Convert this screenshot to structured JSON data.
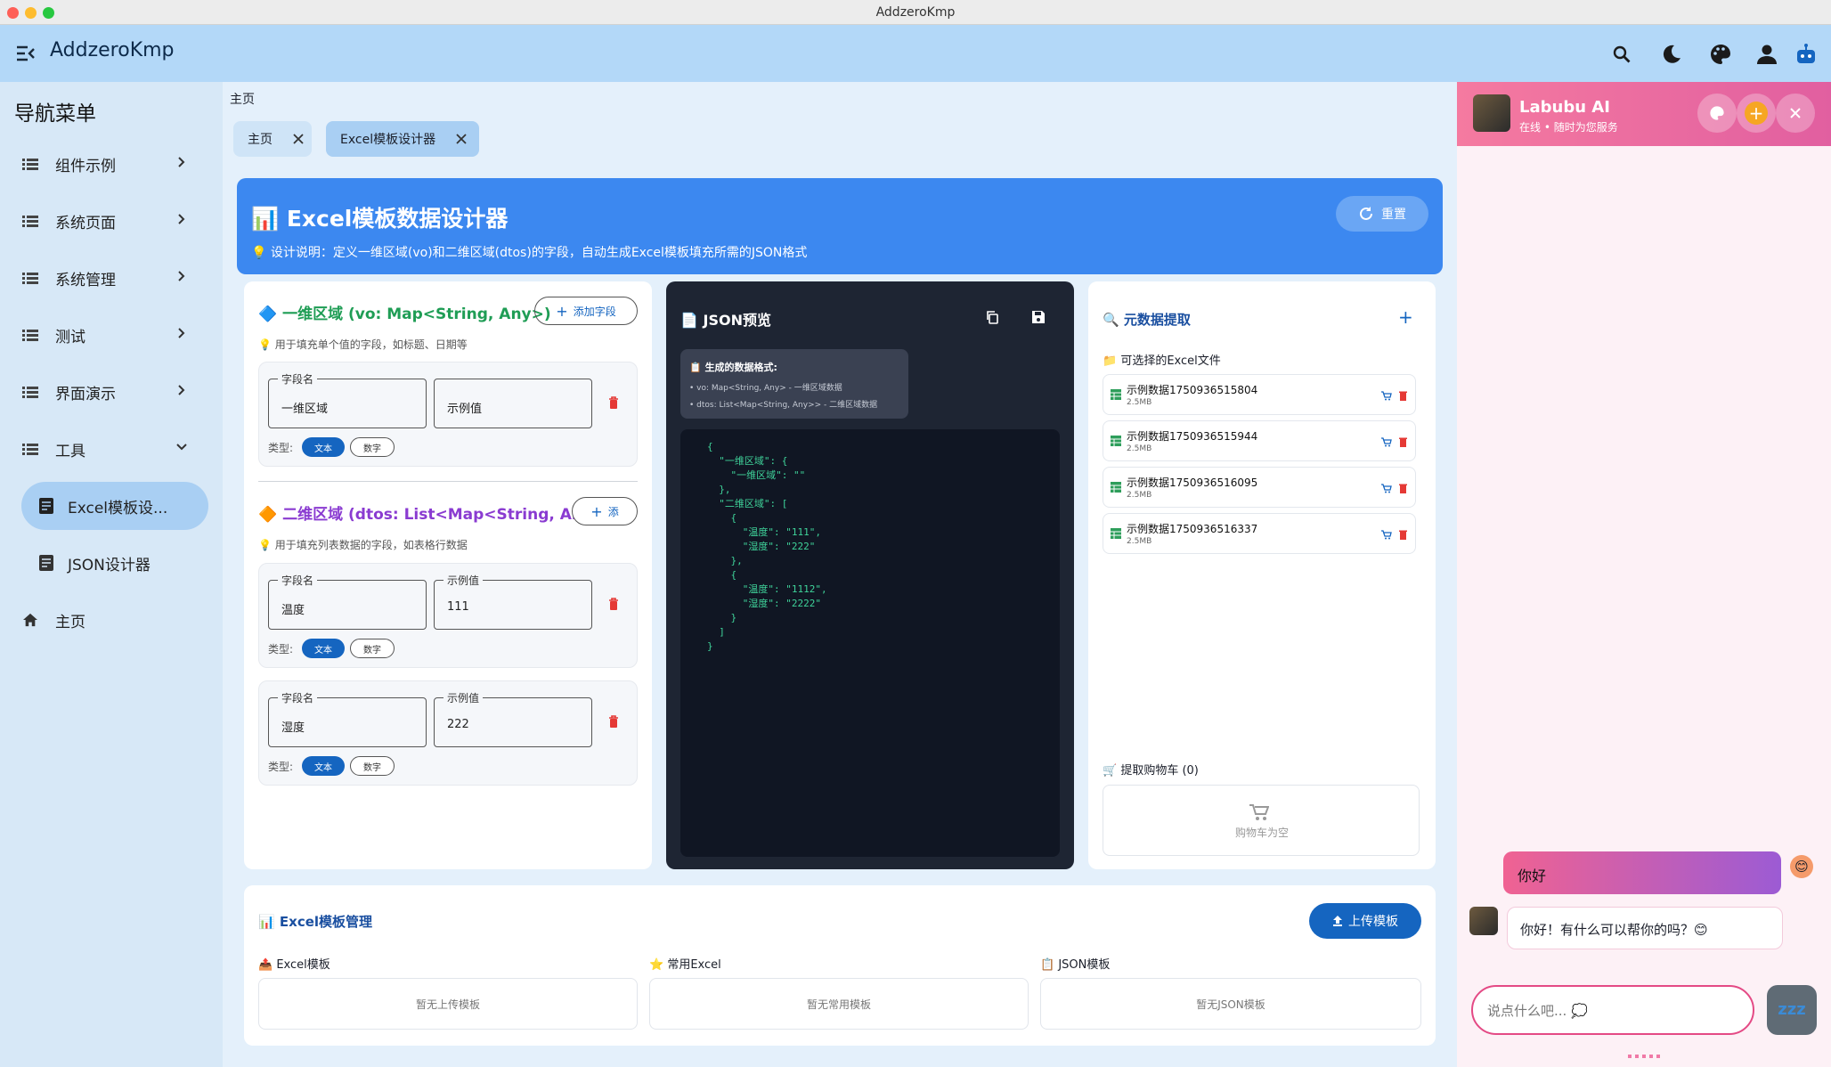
{
  "window": {
    "title": "AddzeroKmp"
  },
  "appbar": {
    "title": "AddzeroKmp",
    "icons": [
      "search-icon",
      "moon-icon",
      "palette-icon",
      "account-icon",
      "robot-icon"
    ]
  },
  "sidebar": {
    "title": "导航菜单",
    "items": [
      {
        "label": "组件示例"
      },
      {
        "label": "系统页面"
      },
      {
        "label": "系统管理"
      },
      {
        "label": "测试"
      },
      {
        "label": "界面演示"
      },
      {
        "label": "工具"
      }
    ],
    "sub_items": [
      {
        "label": "Excel模板设..."
      },
      {
        "label": "JSON设计器"
      }
    ],
    "home": "主页"
  },
  "breadcrumb": "主页",
  "tabs": [
    {
      "label": "主页"
    },
    {
      "label": "Excel模板设计器"
    }
  ],
  "header": {
    "title": "📊 Excel模板数据设计器",
    "desc": "💡 设计说明：定义一维区域(vo)和二维区域(dtos)的字段，自动生成Excel模板填充所需的JSON格式",
    "reset": "重置"
  },
  "vo": {
    "title": "🔷 一维区域 (vo: Map<String, Any>)",
    "add": "添加字段",
    "hint": "💡 用于填充单个值的字段，如标题、日期等",
    "fields": [
      {
        "name_label": "字段名",
        "name": "一维区域",
        "value_label": "",
        "value": "示例值"
      }
    ]
  },
  "dtos": {
    "title": "🔶 二维区域 (dtos: List<Map<String, Any>>)",
    "add": "添",
    "hint": "💡 用于填充列表数据的字段，如表格行数据",
    "fields": [
      {
        "name_label": "字段名",
        "name": "温度",
        "value_label": "示例值",
        "value": "111"
      },
      {
        "name_label": "字段名",
        "name": "湿度",
        "value_label": "示例值",
        "value": "222"
      }
    ]
  },
  "type_row": {
    "label": "类型:",
    "text": "文本",
    "number": "数字"
  },
  "json": {
    "title": "📄 JSON预览",
    "format_title": "📋 生成的数据格式:",
    "line1": "• vo: Map<String, Any> - 一维区域数据",
    "line2": "• dtos: List<Map<String, Any>> - 二维区域数据",
    "code": "{\n  \"一维区域\": {\n    \"一维区域\": \"\"\n  },\n  \"二维区域\": [\n    {\n      \"温度\": \"111\",\n      \"湿度\": \"222\"\n    },\n    {\n      \"温度\": \"1112\",\n      \"湿度\": \"2222\"\n    }\n  ]\n}"
  },
  "meta": {
    "title": "🔍 元数据提取",
    "files_title": "📁 可选择的Excel文件",
    "files": [
      {
        "name": "示例数据1750936515804",
        "size": "2.5MB"
      },
      {
        "name": "示例数据1750936515944",
        "size": "2.5MB"
      },
      {
        "name": "示例数据1750936516095",
        "size": "2.5MB"
      },
      {
        "name": "示例数据1750936516337",
        "size": "2.5MB"
      }
    ],
    "cart_title": "🛒 提取购物车 (0)",
    "cart_empty": "购物车为空"
  },
  "manage": {
    "title": "📊 Excel模板管理",
    "upload": "上传模板",
    "cols": [
      {
        "title": "📤 Excel模板",
        "empty": "暂无上传模板"
      },
      {
        "title": "⭐ 常用Excel",
        "empty": "暂无常用模板"
      },
      {
        "title": "📋 JSON模板",
        "empty": "暂无JSON模板"
      }
    ]
  },
  "chat": {
    "name": "Labubu AI",
    "status": "在线 • 随时为您服务",
    "user_msg": "你好",
    "bot_msg": "你好！有什么可以帮你的吗？😊",
    "placeholder": "说点什么吧... 💭",
    "send_icon": "zzz"
  },
  "colors": {
    "appbar": "#b3d8f8",
    "accent": "#3c88f0",
    "primary": "#1565c0",
    "chat_pink": "#e15fa0"
  }
}
